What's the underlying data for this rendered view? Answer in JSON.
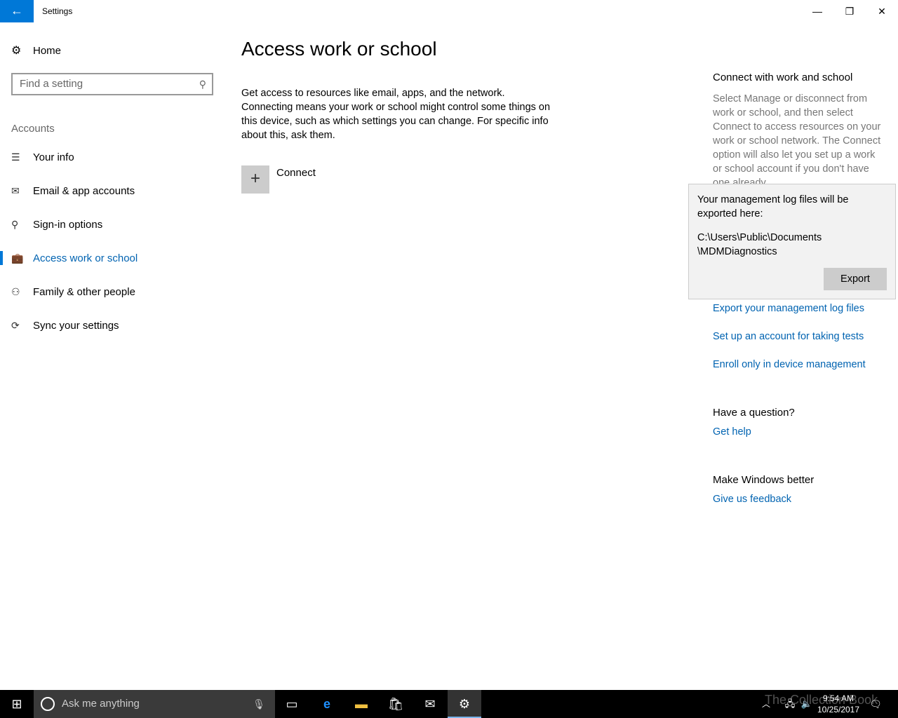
{
  "window": {
    "title": "Settings",
    "back_icon": "arrow-left-icon",
    "minimize": "—",
    "restore": "❐",
    "close": "✕"
  },
  "sidebar": {
    "home": "Home",
    "search_placeholder": "Find a setting",
    "section": "Accounts",
    "items": [
      {
        "label": "Your info",
        "icon": "☰"
      },
      {
        "label": "Email & app accounts",
        "icon": "✉"
      },
      {
        "label": "Sign-in options",
        "icon": "⚲"
      },
      {
        "label": "Access work or school",
        "icon": "💼"
      },
      {
        "label": "Family & other people",
        "icon": "⚇"
      },
      {
        "label": "Sync your settings",
        "icon": "⟳"
      }
    ],
    "selected_color": "#0078d7"
  },
  "main": {
    "title": "Access work or school",
    "description": "Get access to resources like email, apps, and the network. Connecting means your work or school might control some things on this device, such as which settings you can change. For specific info about this, ask them.",
    "connect_label": "Connect"
  },
  "right": {
    "heading": "Connect with work and school",
    "text": "Select Manage or disconnect from work or school, and then select Connect to access resources on your work or school network. The Connect option will also let you set up a work or school account if you don't have one already.",
    "links": [
      "Export your management log files",
      "Set up an account for taking tests",
      "Enroll only in device management"
    ],
    "question": "Have a question?",
    "get_help": "Get help",
    "better": "Make Windows better",
    "feedback": "Give us feedback"
  },
  "popup": {
    "message": "Your management log files will be exported here:",
    "path_line1": "C:\\Users\\Public\\Documents",
    "path_line2": "\\MDMDiagnostics",
    "export": "Export"
  },
  "taskbar": {
    "search_placeholder": "Ask me anything",
    "time": "9:54 AM",
    "date": "10/25/2017",
    "watermark": "The Collection Book"
  }
}
